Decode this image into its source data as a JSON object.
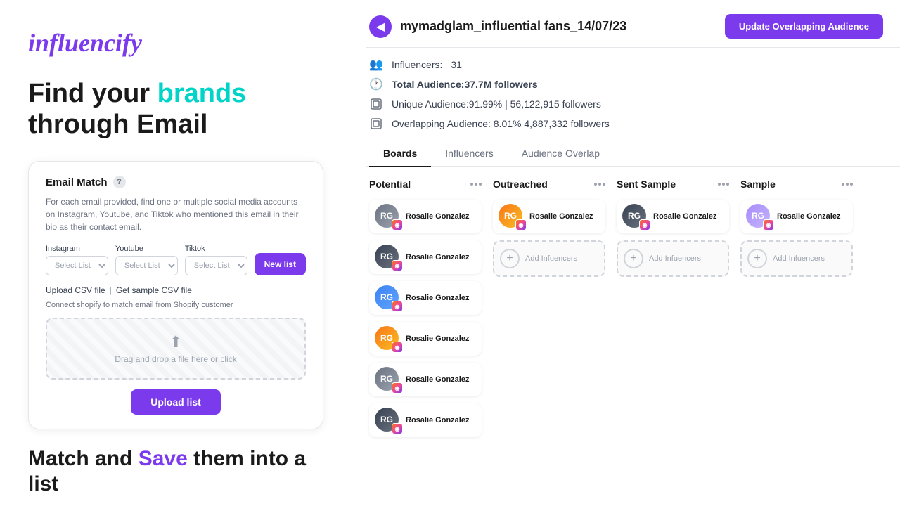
{
  "left": {
    "logo_text": "influencify",
    "headline_part1": "Find your ",
    "headline_brands": "brands",
    "headline_part2": "through Email",
    "email_match": {
      "title": "Email Match",
      "help_label": "?",
      "description": "For each email provided, find one or multiple social media accounts on Instagram, Youtube, and Tiktok who mentioned this email in their bio as their contact email.",
      "instagram_label": "Instagram",
      "youtube_label": "Youtube",
      "tiktok_label": "Tiktok",
      "instagram_placeholder": "Select List",
      "youtube_placeholder": "Select List",
      "tiktok_placeholder": "Select List",
      "new_list_label": "New list",
      "upload_csv_label": "Upload CSV file",
      "csv_sep": "|",
      "sample_csv_label": "Get sample CSV file",
      "shopify_text": "Connect shopify to match email from Shopify customer",
      "dropzone_text": "Drag and drop a file here or click",
      "upload_btn_label": "Upload list"
    },
    "bottom_headline_part1": "Match and ",
    "bottom_headline_save": "Save",
    "bottom_headline_part2": " them into a list"
  },
  "right": {
    "campaign_title": "mymadglam_influential fans_14/07/23",
    "update_btn_label": "Update Overlapping Audience",
    "back_icon": "◀",
    "stats": [
      {
        "icon": "👥",
        "label": "Influencers:",
        "value": "31",
        "bold": false
      },
      {
        "icon": "🕐",
        "label": "Total Audience:",
        "value": "37.7M followers",
        "bold": true
      },
      {
        "icon": "📋",
        "label": "Unique Audience:",
        "value": "91.99% | 56,122,915 followers",
        "bold": false
      },
      {
        "icon": "📋",
        "label": "Overlapping Audience:",
        "value": "8.01%  4,887,332 followers",
        "bold": false
      }
    ],
    "tabs": [
      {
        "label": "Boards",
        "active": true
      },
      {
        "label": "Influencers",
        "active": false
      },
      {
        "label": "Audience Overlap",
        "active": false
      }
    ],
    "boards": [
      {
        "title": "Potential",
        "influencers": [
          {
            "name": "Rosalie Gonzalez",
            "avatar_type": "gray"
          },
          {
            "name": "Rosalie Gonzalez",
            "avatar_type": "dark"
          },
          {
            "name": "Rosalie Gonzalez",
            "avatar_type": "blue"
          },
          {
            "name": "Rosalie Gonzalez",
            "avatar_type": "orange"
          },
          {
            "name": "Rosalie Gonzalez",
            "avatar_type": "gray"
          },
          {
            "name": "Rosalie Gonzalez",
            "avatar_type": "dark"
          }
        ],
        "show_add": false
      },
      {
        "title": "Outreached",
        "influencers": [
          {
            "name": "Rosalie Gonzalez",
            "avatar_type": "orange"
          }
        ],
        "show_add": true
      },
      {
        "title": "Sent Sample",
        "influencers": [
          {
            "name": "Rosalie Gonzalez",
            "avatar_type": "dark"
          }
        ],
        "show_add": true
      },
      {
        "title": "Sample",
        "influencers": [
          {
            "name": "Rosalie Gonzalez",
            "avatar_type": "purple"
          }
        ],
        "show_add": true
      }
    ],
    "add_influencer_label": "Add Infuencers"
  }
}
